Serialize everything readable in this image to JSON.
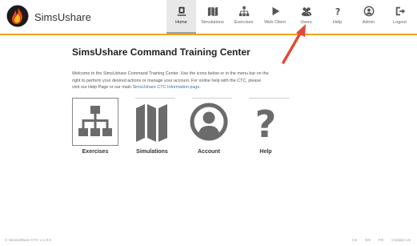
{
  "app": {
    "title": "SimsUshare"
  },
  "nav": {
    "items": [
      {
        "label": "Home",
        "icon": "education-icon",
        "active": true
      },
      {
        "label": "Simulations",
        "icon": "map-icon",
        "active": false
      },
      {
        "label": "Exercises",
        "icon": "sitemap-icon",
        "active": false
      },
      {
        "label": "Web Client",
        "icon": "play-icon",
        "active": false
      },
      {
        "label": "Users",
        "icon": "users-icon",
        "active": false
      },
      {
        "label": "Help",
        "icon": "question-icon",
        "active": false
      },
      {
        "label": "Admin",
        "icon": "user-circle-icon",
        "active": false
      },
      {
        "label": "Logout",
        "icon": "logout-icon",
        "active": false
      }
    ]
  },
  "main": {
    "title": "SimsUshare Command Training Center",
    "intro_part1": "Welcome to the SimsUshare Command Training Center. Use the icons below or in the menu bar on the right to perform your desired actions or manage your account. For online help with the CTC, please visit our Help Page or our main",
    "intro_link": "SimsUshare CTC Information page.",
    "tiles": [
      {
        "label": "Exercises",
        "icon": "sitemap-icon",
        "selected": true
      },
      {
        "label": "Simulations",
        "icon": "map-icon",
        "selected": false
      },
      {
        "label": "Account",
        "icon": "user-circle-icon",
        "selected": false
      },
      {
        "label": "Help",
        "icon": "question-icon",
        "selected": false
      }
    ]
  },
  "footer": {
    "copyright": "© SimsUshare CTC v 1.9.0",
    "links": [
      "CS",
      "EN",
      "FR",
      "Contact Us"
    ]
  },
  "colors": {
    "accent": "#f0a21c",
    "icon_gray": "#666666",
    "arrow": "#e24a3b",
    "link": "#3a72b8"
  }
}
